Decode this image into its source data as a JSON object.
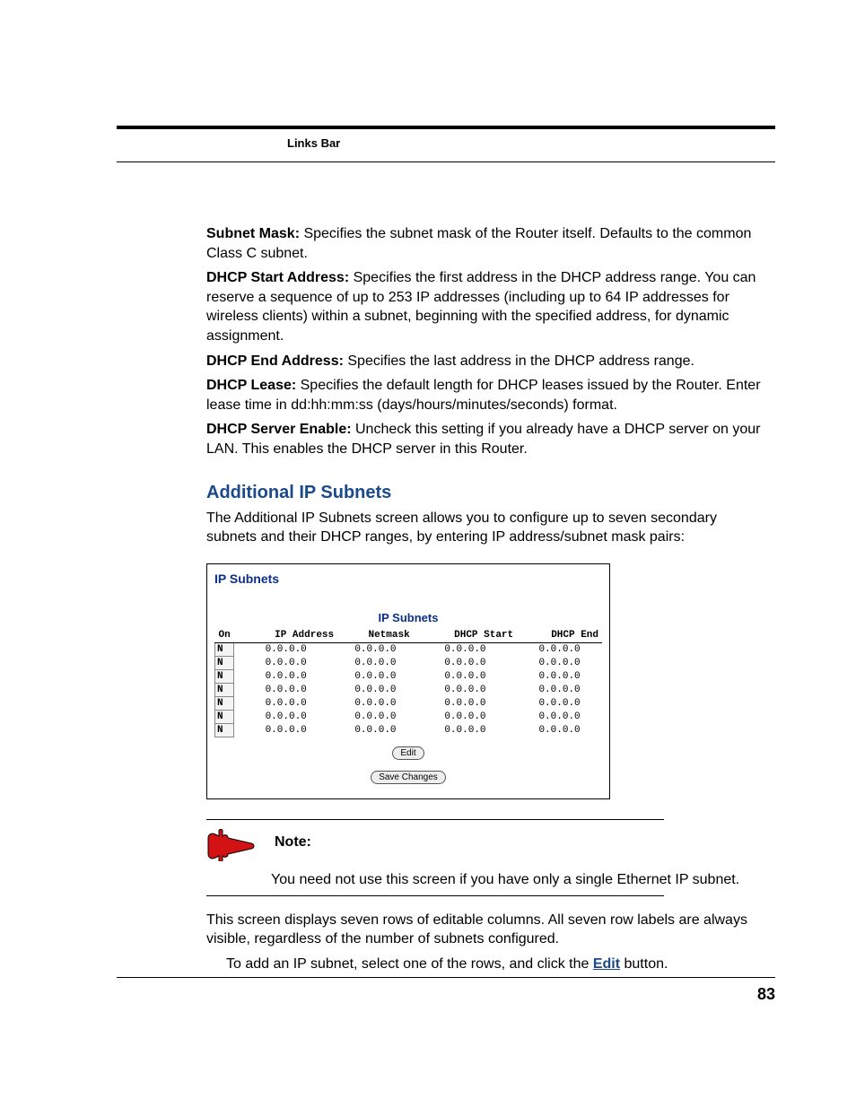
{
  "header": {
    "links_bar": "Links Bar"
  },
  "defs": {
    "subnet_mask": {
      "label": "Subnet Mask:",
      "text": " Specifies the subnet mask of the Router itself. Defaults to the common Class C subnet."
    },
    "dhcp_start": {
      "label": "DHCP Start Address:",
      "text": " Specifies the first address in the DHCP address range. You can reserve a sequence of up to 253 IP addresses (including up to 64 IP addresses for wireless clients) within a subnet, beginning with the specified address, for dynamic assignment."
    },
    "dhcp_end": {
      "label": "DHCP End Address:",
      "text": " Specifies the last address in the DHCP address range."
    },
    "dhcp_lease": {
      "label": "DHCP Lease:",
      "text": " Specifies the default length for DHCP leases issued by the Router. Enter lease time in dd:hh:mm:ss (days/hours/minutes/seconds) format."
    },
    "dhcp_server_enable": {
      "label": "DHCP Server Enable:",
      "text": " Uncheck this setting if you already have a DHCP server on your LAN. This enables the DHCP server in this Router."
    }
  },
  "section": {
    "heading": "Additional IP Subnets",
    "intro": "The Additional IP Subnets screen allows you to configure up to seven secondary subnets and their DHCP ranges, by entering IP address/subnet mask pairs:"
  },
  "subnet_box": {
    "title": "IP Subnets",
    "subtitle": "IP Subnets",
    "columns": {
      "on": "On",
      "ip": "IP Address",
      "netmask": "Netmask",
      "dhcp_start": "DHCP Start",
      "dhcp_end": "DHCP End"
    },
    "rows": [
      {
        "on": "N",
        "ip": "0.0.0.0",
        "netmask": "0.0.0.0",
        "dhcp_start": "0.0.0.0",
        "dhcp_end": "0.0.0.0"
      },
      {
        "on": "N",
        "ip": "0.0.0.0",
        "netmask": "0.0.0.0",
        "dhcp_start": "0.0.0.0",
        "dhcp_end": "0.0.0.0"
      },
      {
        "on": "N",
        "ip": "0.0.0.0",
        "netmask": "0.0.0.0",
        "dhcp_start": "0.0.0.0",
        "dhcp_end": "0.0.0.0"
      },
      {
        "on": "N",
        "ip": "0.0.0.0",
        "netmask": "0.0.0.0",
        "dhcp_start": "0.0.0.0",
        "dhcp_end": "0.0.0.0"
      },
      {
        "on": "N",
        "ip": "0.0.0.0",
        "netmask": "0.0.0.0",
        "dhcp_start": "0.0.0.0",
        "dhcp_end": "0.0.0.0"
      },
      {
        "on": "N",
        "ip": "0.0.0.0",
        "netmask": "0.0.0.0",
        "dhcp_start": "0.0.0.0",
        "dhcp_end": "0.0.0.0"
      },
      {
        "on": "N",
        "ip": "0.0.0.0",
        "netmask": "0.0.0.0",
        "dhcp_start": "0.0.0.0",
        "dhcp_end": "0.0.0.0"
      }
    ],
    "buttons": {
      "edit": "Edit",
      "save": "Save Changes"
    }
  },
  "note": {
    "label": "Note:",
    "text": "You need not use this screen if you have only a single Ethernet IP subnet."
  },
  "tail": {
    "p1": "This screen displays seven rows of editable columns. All seven row labels are always visible, regardless of the number of subnets configured.",
    "p2_pre": "To add an IP subnet, select one of the rows, and click the ",
    "p2_link": "Edit",
    "p2_post": " button."
  },
  "page_number": "83"
}
